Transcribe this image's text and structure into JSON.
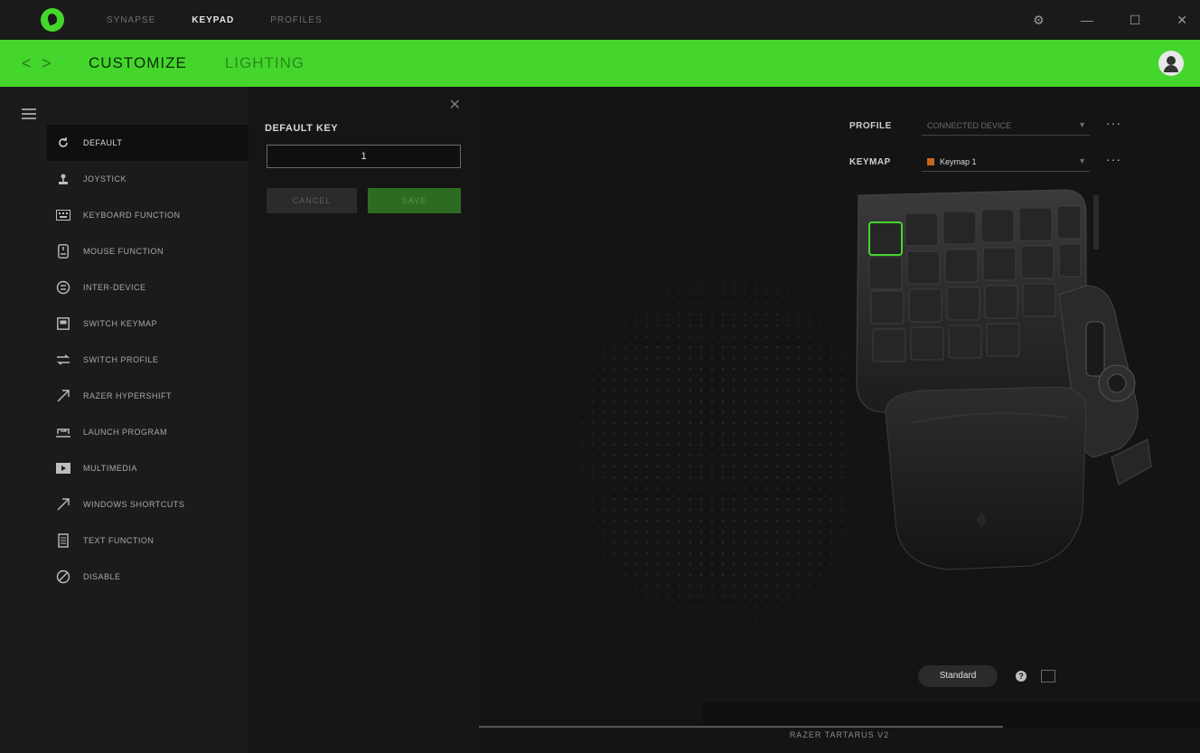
{
  "topbar": {
    "tabs": [
      {
        "label": "SYNAPSE",
        "active": false
      },
      {
        "label": "KEYPAD",
        "active": true
      },
      {
        "label": "PROFILES",
        "active": false
      }
    ],
    "controls": {
      "settings": "⚙",
      "minimize": "—",
      "maximize": "☐",
      "close": "✕"
    }
  },
  "subnav": {
    "back": "<",
    "forward": ">",
    "tabs": [
      {
        "label": "CUSTOMIZE",
        "active": true
      },
      {
        "label": "LIGHTING",
        "active": false
      }
    ]
  },
  "menu": {
    "items": [
      {
        "label": "DEFAULT",
        "icon": "default-icon",
        "selected": true
      },
      {
        "label": "JOYSTICK",
        "icon": "joystick-icon",
        "selected": false
      },
      {
        "label": "KEYBOARD FUNCTION",
        "icon": "keyboard-icon",
        "selected": false
      },
      {
        "label": "MOUSE FUNCTION",
        "icon": "mouse-icon",
        "selected": false
      },
      {
        "label": "INTER-DEVICE",
        "icon": "inter-device-icon",
        "selected": false
      },
      {
        "label": "SWITCH KEYMAP",
        "icon": "switch-keymap-icon",
        "selected": false
      },
      {
        "label": "SWITCH PROFILE",
        "icon": "switch-profile-icon",
        "selected": false
      },
      {
        "label": "RAZER HYPERSHIFT",
        "icon": "hypershift-icon",
        "selected": false
      },
      {
        "label": "LAUNCH PROGRAM",
        "icon": "launch-program-icon",
        "selected": false
      },
      {
        "label": "MULTIMEDIA",
        "icon": "multimedia-icon",
        "selected": false
      },
      {
        "label": "WINDOWS SHORTCUTS",
        "icon": "windows-shortcuts-icon",
        "selected": false
      },
      {
        "label": "TEXT FUNCTION",
        "icon": "text-function-icon",
        "selected": false
      },
      {
        "label": "DISABLE",
        "icon": "disable-icon",
        "selected": false
      }
    ]
  },
  "keypanel": {
    "title": "DEFAULT KEY",
    "value": "1",
    "cancel": "CANCEL",
    "save": "SAVE"
  },
  "main": {
    "profile_label": "PROFILE",
    "profile_value": "CONNECTED DEVICE",
    "keymap_label": "KEYMAP",
    "keymap_value": "Keymap 1",
    "more": "···",
    "view_mode": "Standard",
    "help": "?",
    "device_name": "RAZER TARTARUS V2",
    "accent_color": "#44d62c"
  }
}
